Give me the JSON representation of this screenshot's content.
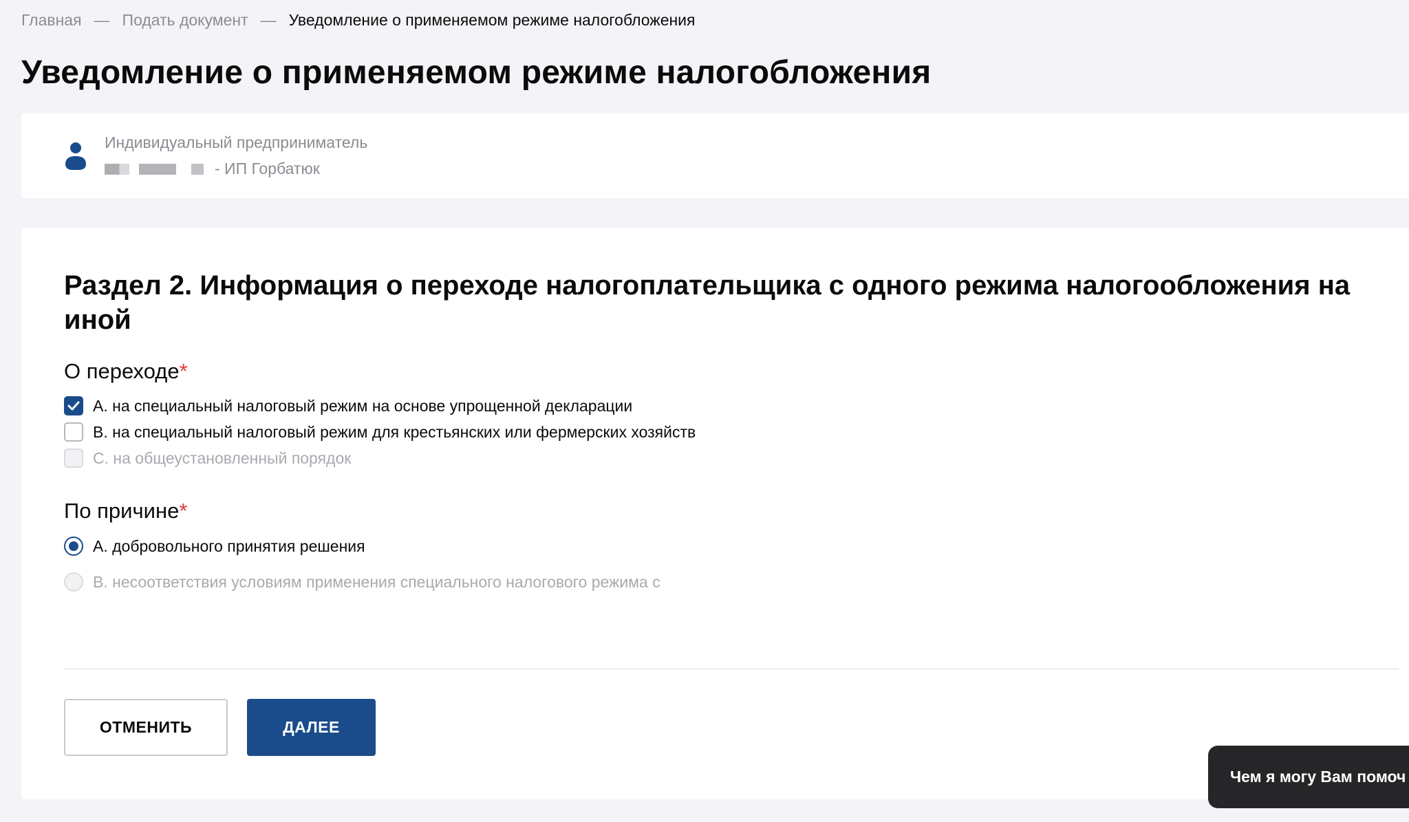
{
  "breadcrumb": {
    "items": [
      "Главная",
      "Подать документ"
    ],
    "separator": "—",
    "current": "Уведомление о применяемом режиме налогобложения"
  },
  "page": {
    "title": "Уведомление о применяемом режиме налогобложения"
  },
  "profile": {
    "icon": "person-icon",
    "role": "Индивидуальный предприниматель",
    "name": "- ИП Горбатюк"
  },
  "form": {
    "section_title": "Раздел 2. Информация о переходе налогоплательщика с одного режима налогообложения на иной",
    "required_mark": "*",
    "transition": {
      "label": "О переходе",
      "options": [
        {
          "label": "А. на специальный налоговый режим на основе упрощенной декларации",
          "checked": true,
          "disabled": false
        },
        {
          "label": "В. на специальный налоговый режим для крестьянских или фермерских хозяйств",
          "checked": false,
          "disabled": false
        },
        {
          "label": "С. на общеустановленный порядок",
          "checked": false,
          "disabled": true
        }
      ]
    },
    "reason": {
      "label": "По причине",
      "options": [
        {
          "label": "А. добровольного принятия решения",
          "selected": true,
          "disabled": false
        },
        {
          "label": "В. несоответствия условиям применения специального налогового режима с",
          "selected": false,
          "disabled": true
        }
      ]
    },
    "buttons": {
      "cancel": "ОТМЕНИТЬ",
      "next": "ДАЛЕЕ"
    }
  },
  "chat": {
    "label": "Чем я могу Вам помоч"
  },
  "colors": {
    "primary": "#1a4c8b",
    "background": "#f4f4f8",
    "required": "#e5383b",
    "chat_bg": "#262629"
  }
}
